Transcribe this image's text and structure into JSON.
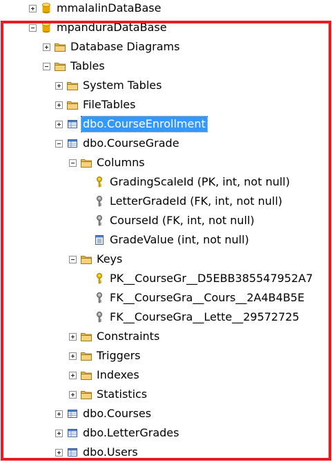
{
  "tree": [
    {
      "label": "mmalalinDataBase",
      "level": 0,
      "expand": "plus",
      "icon": "database-icon",
      "name": "tree-node-mmalalindatabase"
    },
    {
      "label": "mpanduraDataBase",
      "level": 0,
      "expand": "minus",
      "icon": "database-icon",
      "name": "tree-node-mpanduradatabase"
    },
    {
      "label": "Database Diagrams",
      "level": 1,
      "expand": "plus",
      "icon": "folder-icon",
      "name": "tree-node-database-diagrams"
    },
    {
      "label": "Tables",
      "level": 1,
      "expand": "minus",
      "icon": "folder-icon",
      "name": "tree-node-tables"
    },
    {
      "label": "System Tables",
      "level": 2,
      "expand": "plus",
      "icon": "folder-icon",
      "name": "tree-node-system-tables"
    },
    {
      "label": "FileTables",
      "level": 2,
      "expand": "plus",
      "icon": "folder-icon",
      "name": "tree-node-filetables"
    },
    {
      "label": "dbo.CourseEnrollment",
      "level": 2,
      "expand": "plus",
      "icon": "table-icon",
      "name": "tree-node-dbo-courseenrollment",
      "selected": true
    },
    {
      "label": "dbo.CourseGrade",
      "level": 2,
      "expand": "minus",
      "icon": "table-icon",
      "name": "tree-node-dbo-coursegrade"
    },
    {
      "label": "Columns",
      "level": 3,
      "expand": "minus",
      "icon": "folder-icon",
      "name": "tree-node-columns"
    },
    {
      "label": "GradingScaleId (PK, int, not null)",
      "level": 4,
      "expand": "none",
      "icon": "primary-key-icon",
      "name": "tree-node-gradingscaleid"
    },
    {
      "label": "LetterGradeId (FK, int, not null)",
      "level": 4,
      "expand": "none",
      "icon": "foreign-key-icon",
      "name": "tree-node-lettergradeid"
    },
    {
      "label": "CourseId (FK, int, not null)",
      "level": 4,
      "expand": "none",
      "icon": "foreign-key-icon",
      "name": "tree-node-courseid"
    },
    {
      "label": "GradeValue (int, not null)",
      "level": 4,
      "expand": "none",
      "icon": "column-icon",
      "name": "tree-node-gradevalue"
    },
    {
      "label": "Keys",
      "level": 3,
      "expand": "minus",
      "icon": "folder-icon",
      "name": "tree-node-keys"
    },
    {
      "label": "PK__CourseGr__D5EBB385547952A7",
      "level": 4,
      "expand": "none",
      "icon": "primary-key-icon",
      "name": "tree-node-pk-coursegr"
    },
    {
      "label": "FK__CourseGra__Cours__2A4B4B5E",
      "level": 4,
      "expand": "none",
      "icon": "foreign-key-icon",
      "name": "tree-node-fk-coursegra-cours"
    },
    {
      "label": "FK__CourseGra__Lette__29572725",
      "level": 4,
      "expand": "none",
      "icon": "foreign-key-icon",
      "name": "tree-node-fk-coursegra-lette"
    },
    {
      "label": "Constraints",
      "level": 3,
      "expand": "plus",
      "icon": "folder-icon",
      "name": "tree-node-constraints"
    },
    {
      "label": "Triggers",
      "level": 3,
      "expand": "plus",
      "icon": "folder-icon",
      "name": "tree-node-triggers"
    },
    {
      "label": "Indexes",
      "level": 3,
      "expand": "plus",
      "icon": "folder-icon",
      "name": "tree-node-indexes"
    },
    {
      "label": "Statistics",
      "level": 3,
      "expand": "plus",
      "icon": "folder-icon",
      "name": "tree-node-statistics"
    },
    {
      "label": "dbo.Courses",
      "level": 2,
      "expand": "plus",
      "icon": "table-icon",
      "name": "tree-node-dbo-courses"
    },
    {
      "label": "dbo.LetterGrades",
      "level": 2,
      "expand": "plus",
      "icon": "table-icon",
      "name": "tree-node-dbo-lettergrades"
    },
    {
      "label": "dbo.Users",
      "level": 2,
      "expand": "plus",
      "icon": "table-icon",
      "name": "tree-node-dbo-users"
    }
  ]
}
